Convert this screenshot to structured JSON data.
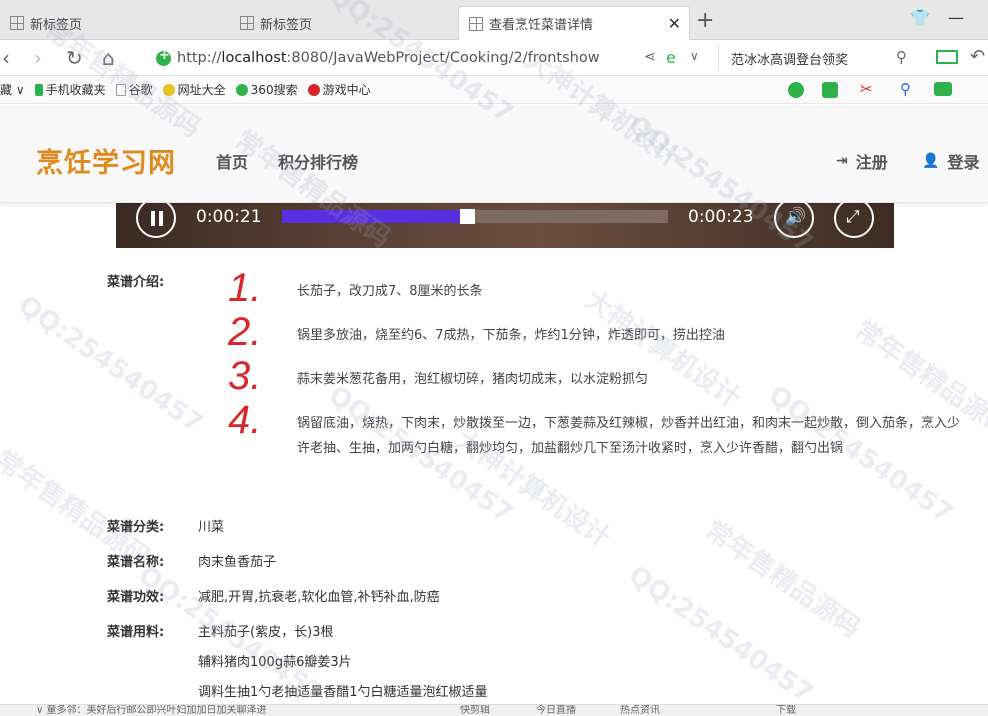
{
  "browser": {
    "tabs": [
      {
        "title": "新标签页"
      },
      {
        "title": "新标签页"
      },
      {
        "title": "查看烹饪菜谱详情",
        "active": true
      }
    ],
    "url_prefix": "http://",
    "url_host": "localhost",
    "url_path": ":8080/JavaWebProject/Cooking/2/frontshow",
    "search_text": "范冰冰高调登台领奖",
    "bookmarks": [
      "藏",
      "手机收藏夹",
      "谷歌",
      "网址大全",
      "360搜索",
      "游戏中心"
    ]
  },
  "site": {
    "brand": "烹饪学习网",
    "nav": [
      "首页",
      "积分排行榜"
    ],
    "register": "注册",
    "login": "登录",
    "brand_color": "#e08a1e"
  },
  "video": {
    "current_time": "0:00:21",
    "duration": "0:00:23",
    "progress": 0.48
  },
  "recipe": {
    "intro_label": "菜谱介绍:",
    "steps": [
      {
        "num": "1.",
        "text": "长茄子，改刀成7、8厘米的长条"
      },
      {
        "num": "2.",
        "text": "锅里多放油，烧至约6、7成热，下茄条，炸约1分钟，炸透即可，捞出控油"
      },
      {
        "num": "3.",
        "text": "蒜末姜米葱花备用，泡红椒切碎，猪肉切成末，以水淀粉抓匀"
      },
      {
        "num": "4.",
        "text": "锅留底油，烧热，下肉末，炒散拨至一边，下葱姜蒜及红辣椒，炒香并出红油，和肉末一起炒散，倒入茄条，烹入少许老抽、生抽，加两勺白糖，翻炒均匀，加盐翻炒几下至汤汁收紧时，烹入少许香醋，翻勺出锅"
      }
    ],
    "category_label": "菜谱分类:",
    "category": "川菜",
    "name_label": "菜谱名称:",
    "name": "肉末鱼香茄子",
    "effect_label": "菜谱功效:",
    "effect": "减肥,开胃,抗衰老,软化血管,补钙补血,防癌",
    "ingredients_label": "菜谱用料:",
    "ingredients": [
      "主料茄子(紫皮，长)3根",
      "辅料猪肉100g蒜6瓣姜3片",
      "调料生抽1勺老抽适量香醋1勺白糖适量泡红椒适量"
    ]
  },
  "status": {
    "text": "∨ 童多邻：美好后行邮公即兴叶妇加加日加关聊泽进",
    "items": [
      "快剪辑",
      "今日直播",
      "热点资讯",
      "下载"
    ]
  },
  "watermarks": [
    "QQ:254540457",
    "常年售精品源码",
    "大神计算机设计"
  ]
}
